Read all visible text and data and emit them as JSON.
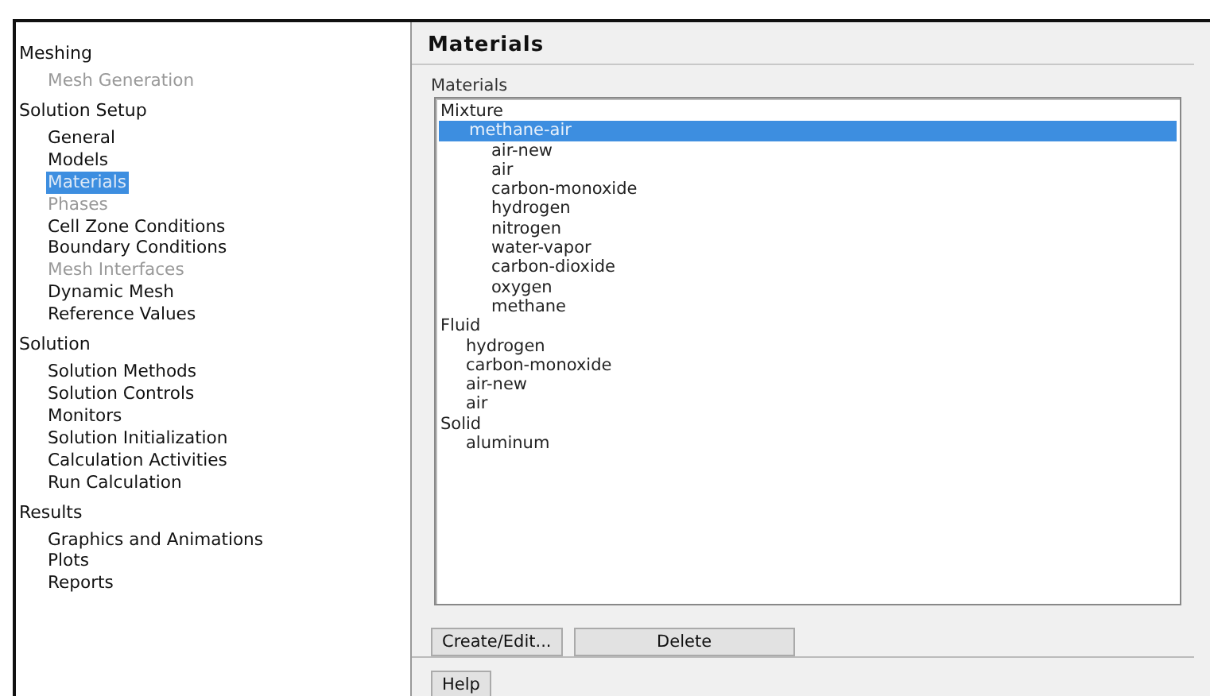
{
  "sidebar": {
    "groups": [
      {
        "label": "Meshing",
        "children": [
          {
            "label": "Mesh Generation",
            "selected": false,
            "disabled": true
          }
        ]
      },
      {
        "label": "Solution Setup",
        "children": [
          {
            "label": "General",
            "selected": false,
            "disabled": false
          },
          {
            "label": "Models",
            "selected": false,
            "disabled": false
          },
          {
            "label": "Materials",
            "selected": true,
            "disabled": false
          },
          {
            "label": "Phases",
            "selected": false,
            "disabled": true
          },
          {
            "label": "Cell Zone Conditions",
            "selected": false,
            "disabled": false
          },
          {
            "label": "Boundary Conditions",
            "selected": false,
            "disabled": false
          },
          {
            "label": "Mesh Interfaces",
            "selected": false,
            "disabled": true
          },
          {
            "label": "Dynamic Mesh",
            "selected": false,
            "disabled": false
          },
          {
            "label": "Reference Values",
            "selected": false,
            "disabled": false
          }
        ]
      },
      {
        "label": "Solution",
        "children": [
          {
            "label": "Solution Methods",
            "selected": false,
            "disabled": false
          },
          {
            "label": "Solution Controls",
            "selected": false,
            "disabled": false
          },
          {
            "label": "Monitors",
            "selected": false,
            "disabled": false
          },
          {
            "label": "Solution Initialization",
            "selected": false,
            "disabled": false
          },
          {
            "label": "Calculation Activities",
            "selected": false,
            "disabled": false
          },
          {
            "label": "Run Calculation",
            "selected": false,
            "disabled": false
          }
        ]
      },
      {
        "label": "Results",
        "children": [
          {
            "label": "Graphics and Animations",
            "selected": false,
            "disabled": false
          },
          {
            "label": "Plots",
            "selected": false,
            "disabled": false
          },
          {
            "label": "Reports",
            "selected": false,
            "disabled": false
          }
        ]
      }
    ]
  },
  "panel": {
    "title": "Materials",
    "list_label": "Materials",
    "materials": [
      {
        "label": "Mixture",
        "selected": false,
        "children": [
          {
            "label": "methane-air",
            "selected": true,
            "children": [
              {
                "label": "air-new",
                "selected": false
              },
              {
                "label": "air",
                "selected": false
              },
              {
                "label": "carbon-monoxide",
                "selected": false
              },
              {
                "label": "hydrogen",
                "selected": false
              },
              {
                "label": "nitrogen",
                "selected": false
              },
              {
                "label": "water-vapor",
                "selected": false
              },
              {
                "label": "carbon-dioxide",
                "selected": false
              },
              {
                "label": "oxygen",
                "selected": false
              },
              {
                "label": "methane",
                "selected": false
              }
            ]
          }
        ]
      },
      {
        "label": "Fluid",
        "selected": false,
        "children": [
          {
            "label": "hydrogen",
            "selected": false
          },
          {
            "label": "carbon-monoxide",
            "selected": false
          },
          {
            "label": "air-new",
            "selected": false
          },
          {
            "label": "air",
            "selected": false
          }
        ]
      },
      {
        "label": "Solid",
        "selected": false,
        "children": [
          {
            "label": "aluminum",
            "selected": false
          }
        ]
      }
    ],
    "buttons": [
      "Create/Edit...",
      "Delete"
    ],
    "help_button": "Help"
  }
}
